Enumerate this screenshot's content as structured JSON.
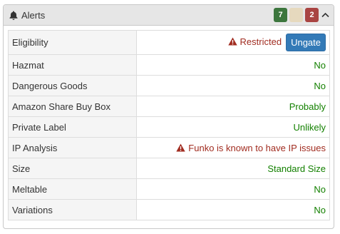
{
  "header": {
    "title": "Alerts",
    "icon": "bell-icon",
    "badges": [
      {
        "value": "7",
        "color": "#3c763d"
      },
      {
        "value": "",
        "color": "#e6d9be"
      },
      {
        "value": "2",
        "color": "#a94442"
      }
    ],
    "collapse_icon": "chevron-up-icon"
  },
  "rows": [
    {
      "label": "Eligibility",
      "value": "Restricted",
      "status": "red",
      "warning": true,
      "button": "Ungate"
    },
    {
      "label": "Hazmat",
      "value": "No",
      "status": "green"
    },
    {
      "label": "Dangerous Goods",
      "value": "No",
      "status": "green"
    },
    {
      "label": "Amazon Share Buy Box",
      "value": "Probably",
      "status": "green"
    },
    {
      "label": "Private Label",
      "value": "Unlikely",
      "status": "green"
    },
    {
      "label": "IP Analysis",
      "value": "Funko is known to have IP issues",
      "status": "red",
      "warning": true
    },
    {
      "label": "Size",
      "value": "Standard Size",
      "status": "green"
    },
    {
      "label": "Meltable",
      "value": "No",
      "status": "green"
    },
    {
      "label": "Variations",
      "value": "No",
      "status": "green"
    }
  ],
  "colors": {
    "green": "#138000",
    "red": "#a12c20",
    "button": "#337ab7"
  }
}
